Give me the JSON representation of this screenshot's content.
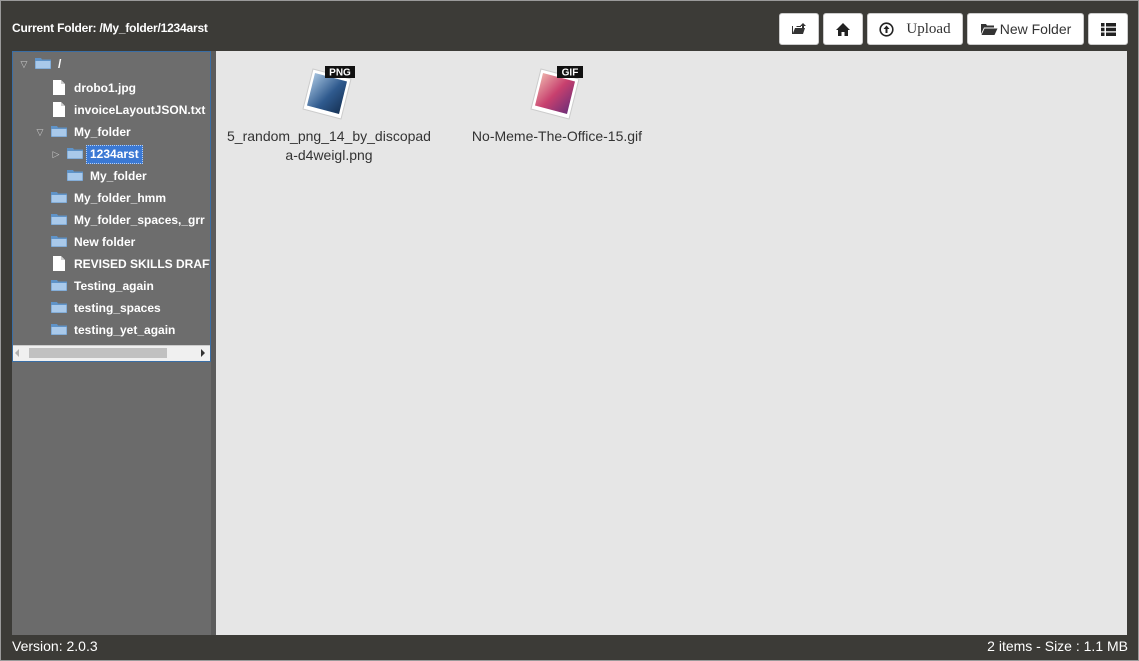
{
  "header": {
    "current_folder": "Current Folder: /My_folder/1234arst",
    "buttons": {
      "upload_label": "Upload",
      "new_folder_label": "New Folder",
      "up_icon": "folder-up-icon",
      "home_icon": "home-icon",
      "upload_icon": "upload-circle-icon",
      "new_folder_icon": "folder-open-icon",
      "view_icon": "list-view-icon"
    }
  },
  "tree": {
    "nodes": [
      {
        "label": "/",
        "type": "folder",
        "expanded": true
      },
      {
        "label": "drobo1.jpg",
        "type": "file"
      },
      {
        "label": "invoiceLayoutJSON.txt",
        "type": "file"
      },
      {
        "label": "My_folder",
        "type": "folder",
        "expanded": true
      },
      {
        "label": "1234arst",
        "type": "folder",
        "selected": true
      },
      {
        "label": "My_folder",
        "type": "folder"
      },
      {
        "label": "My_folder_hmm",
        "type": "folder"
      },
      {
        "label": "My_folder_spaces,_grr",
        "type": "folder"
      },
      {
        "label": "New folder",
        "type": "folder"
      },
      {
        "label": "REVISED SKILLS DRAFT",
        "type": "file"
      },
      {
        "label": "Testing_again",
        "type": "folder"
      },
      {
        "label": "testing_spaces",
        "type": "folder"
      },
      {
        "label": "testing_yet_again",
        "type": "folder"
      }
    ]
  },
  "files": [
    {
      "name": "5_random_png_14_by_discopada-d4weigl.png",
      "badge": "PNG",
      "colors": [
        "#bcd7ef",
        "#2f5a8e",
        "#0f2747"
      ]
    },
    {
      "name": "No-Meme-The-Office-15.gif",
      "badge": "GIF",
      "colors": [
        "#f4c9b8",
        "#c8406e",
        "#5a2a7a"
      ]
    }
  ],
  "footer": {
    "version": "Version: 2.0.3",
    "summary": "2 items - Size : 1.1 MB"
  },
  "colors": {
    "background": "#3c3b37",
    "sidebar": "#6b6b6b",
    "main": "#e6e6e6",
    "selected": "#3b79d4"
  }
}
